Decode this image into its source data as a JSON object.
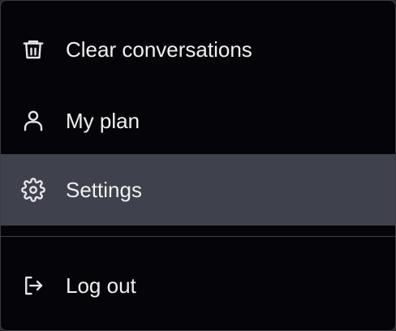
{
  "menu": {
    "items": [
      {
        "label": "Clear conversations",
        "icon": "trash-icon"
      },
      {
        "label": "My plan",
        "icon": "user-icon"
      },
      {
        "label": "Settings",
        "icon": "gear-icon",
        "active": true
      },
      {
        "label": "Log out",
        "icon": "logout-icon"
      }
    ]
  },
  "colors": {
    "menu_background": "#050509",
    "active_item_background": "#3f414c",
    "text": "#f0f0f2",
    "divider": "#3c3d43"
  }
}
